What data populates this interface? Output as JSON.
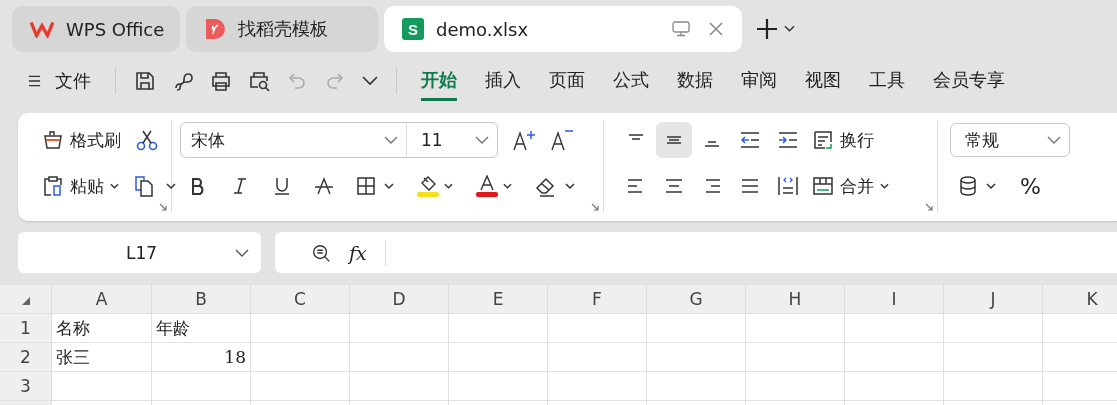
{
  "tabs": [
    {
      "kind": "wps",
      "label": "WPS Office",
      "selected": false
    },
    {
      "kind": "template",
      "label": "找稻壳模板",
      "selected": false
    },
    {
      "kind": "sheet",
      "label": "demo.xlsx",
      "selected": true,
      "logo_letter": "S"
    }
  ],
  "menu": {
    "file_label": "文件",
    "ribbon_tabs": [
      {
        "label": "开始",
        "selected": true
      },
      {
        "label": "插入",
        "selected": false
      },
      {
        "label": "页面",
        "selected": false
      },
      {
        "label": "公式",
        "selected": false
      },
      {
        "label": "数据",
        "selected": false
      },
      {
        "label": "审阅",
        "selected": false
      },
      {
        "label": "视图",
        "selected": false
      },
      {
        "label": "工具",
        "selected": false
      },
      {
        "label": "会员专享",
        "selected": false
      }
    ]
  },
  "ribbon": {
    "format_painter": "格式刷",
    "paste": "粘贴",
    "font": "宋体",
    "font_size": "11",
    "color_buttons": [
      {
        "kind": "fill",
        "color": "#f2e21e"
      },
      {
        "kind": "font",
        "color": "#e01a1a"
      }
    ],
    "align_buttons": [
      {
        "kind": "top",
        "selected": false
      },
      {
        "kind": "middle",
        "selected": true
      },
      {
        "kind": "bottom",
        "selected": false
      },
      {
        "kind": "outdent",
        "selected": false
      },
      {
        "kind": "indent",
        "selected": false
      },
      {
        "kind": "left",
        "selected": false
      },
      {
        "kind": "center",
        "selected": false
      },
      {
        "kind": "right",
        "selected": false
      },
      {
        "kind": "justify",
        "selected": false
      },
      {
        "kind": "distributed",
        "selected": false
      }
    ],
    "wrap": "换行",
    "merge": "合并",
    "number_format": "常规",
    "percent": "%"
  },
  "formula_bar": {
    "name_box": "L17",
    "fx": "fx"
  },
  "sheet": {
    "columns": [
      "A",
      "B",
      "C",
      "D",
      "E",
      "F",
      "G",
      "H",
      "I",
      "J",
      "K"
    ],
    "rows": [
      {
        "label": "1",
        "cells": [
          {
            "text": "名称",
            "kind": "text"
          },
          {
            "text": "年龄",
            "kind": "text"
          }
        ]
      },
      {
        "label": "2",
        "cells": [
          {
            "text": "张三",
            "kind": "text"
          },
          {
            "text": "18",
            "kind": "number"
          }
        ]
      },
      {
        "label": "3",
        "cells": []
      }
    ]
  }
}
